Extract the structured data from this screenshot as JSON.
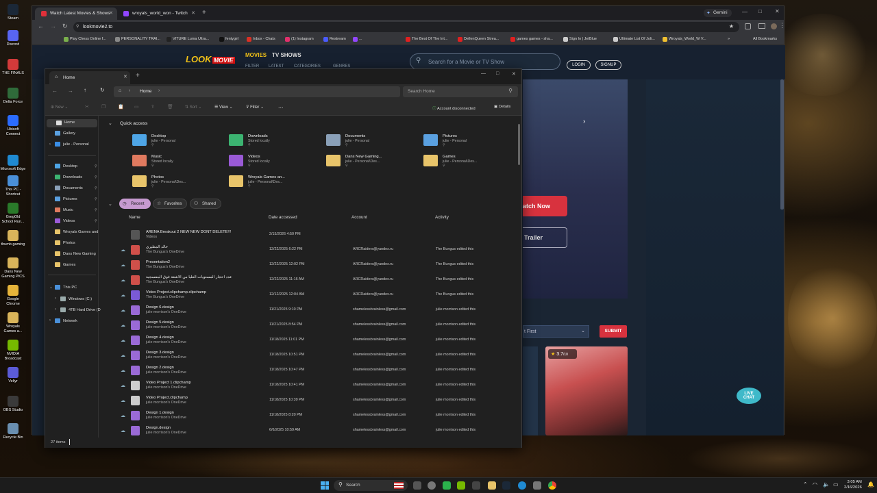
{
  "desktop": {
    "icons": [
      {
        "label": "Steam",
        "color": "#1b2838"
      },
      {
        "label": "Discord",
        "color": "#5865f2"
      },
      {
        "label": "THE FINALS",
        "color": "#d23a3a"
      },
      {
        "label": "Delta Force",
        "color": "#2f6b3a"
      },
      {
        "label": "Ubisoft Connect",
        "color": "#2b6cff"
      },
      {
        "label": "Microsoft Edge",
        "color": "#1f8ad2"
      },
      {
        "label": "This PC - Shortcut",
        "color": "#4a90d9"
      },
      {
        "label": "GregOld School Run...",
        "color": "#2a7a2a"
      },
      {
        "label": "thumb gaming",
        "color": "#d9b45a"
      },
      {
        "label": "Dans New Gaming PICS",
        "color": "#d9b45a"
      },
      {
        "label": "Google Chrome",
        "color": "#e6b43a"
      },
      {
        "label": "Wroyals Games a...",
        "color": "#d9b45a"
      },
      {
        "label": "NVIDIA Broadcast",
        "color": "#76b900"
      },
      {
        "label": "Vellyr",
        "color": "#5b5bd6"
      },
      {
        "label": "OBS Studio",
        "color": "#3a3a3a"
      },
      {
        "label": "Recycle Bin",
        "color": "#6a8fb0"
      }
    ]
  },
  "chrome": {
    "tabs": [
      {
        "title": "Watch Latest Movies & Shows",
        "active": true,
        "favicon": "#e0303a"
      },
      {
        "title": "wroyals_world_won - Twitch",
        "active": false,
        "favicon": "#9146ff"
      }
    ],
    "new_tab": "+",
    "gemini_label": "Gemini",
    "url": "lookmovie2.to",
    "bookmarks": [
      {
        "label": "Play Chess Online f...",
        "color": "#7ab04c"
      },
      {
        "label": "PERSONALITY TRAI...",
        "color": "#888888"
      },
      {
        "label": "VITURE Luma Ultra...",
        "color": "#222222"
      },
      {
        "label": "fentygirl",
        "color": "#111111"
      },
      {
        "label": "Inbox - Chats",
        "color": "#d93025"
      },
      {
        "label": "(1) Instagram",
        "color": "#e1306c"
      },
      {
        "label": "Restream",
        "color": "#4a5bff"
      },
      {
        "label": "...",
        "color": "#9146ff"
      },
      {
        "label": "The Best Of The Int...",
        "color": "#e02020"
      },
      {
        "label": "DellenQueen Strea...",
        "color": "#e02020"
      },
      {
        "label": "games games - sha...",
        "color": "#e02020"
      },
      {
        "label": "Sign In | JetBlue",
        "color": "#cccccc"
      },
      {
        "label": "Ultimate List Of Joli...",
        "color": "#cccccc"
      },
      {
        "label": "Wroyals_World_W V...",
        "color": "#f0c030"
      }
    ],
    "all_bookmarks": "All Bookmarks"
  },
  "site": {
    "logo_look": "LOOK",
    "logo_movie": "MOVIE",
    "nav": [
      "MOVIES",
      "TV SHOWS"
    ],
    "subnav": [
      "FILTER",
      "LATEST",
      "CATEGORIES",
      "GENRES"
    ],
    "search_placeholder": "Search for a Movie or TV Show",
    "login": "LOGIN",
    "signup": "SIGNUP",
    "watch_now": "atch Now",
    "trailer": "Trailer",
    "sort_value": "t First",
    "submit": "SUBMIT",
    "rating": "3.7",
    "rating_max": "/10",
    "live_chat": "LIVE CHAT"
  },
  "explorer": {
    "tab_title": "Home",
    "breadcrumb": "Home",
    "search_placeholder": "Search Home",
    "cmd": {
      "new": "New",
      "sort": "Sort",
      "view": "View",
      "filter": "Filter",
      "more": "...",
      "account": "Account disconnected",
      "details": "Details"
    },
    "nav": {
      "top": [
        {
          "label": "Home",
          "color": "#ddd"
        },
        {
          "label": "Gallery",
          "color": "#5aa0e0"
        },
        {
          "label": "julie - Personal",
          "color": "#3a8ee6"
        }
      ],
      "pinned": [
        {
          "label": "Desktop",
          "color": "#4ea5e6"
        },
        {
          "label": "Downloads",
          "color": "#3cb371"
        },
        {
          "label": "Documents",
          "color": "#8aa0b8"
        },
        {
          "label": "Pictures",
          "color": "#5aa0e0"
        },
        {
          "label": "Music",
          "color": "#e07a5f"
        },
        {
          "label": "Videos",
          "color": "#9a5ad6"
        },
        {
          "label": "Wroyals Games and",
          "color": "#e8c46a"
        },
        {
          "label": "Photos",
          "color": "#e8c46a"
        },
        {
          "label": "Dans New Gaming",
          "color": "#e8c46a"
        },
        {
          "label": "Games",
          "color": "#e8c46a"
        }
      ],
      "drives": [
        {
          "label": "This PC",
          "color": "#4a90d9"
        },
        {
          "label": "Windows (C:)",
          "color": "#9aa"
        },
        {
          "label": "4TB Hard Drive (D",
          "color": "#9aa"
        },
        {
          "label": "Network",
          "color": "#4a90d9"
        }
      ]
    },
    "quick_access_title": "Quick access",
    "quick_access": [
      {
        "name": "Desktop",
        "sub": "julie - Personal",
        "color": "#4ea5e6"
      },
      {
        "name": "Downloads",
        "sub": "Stored locally",
        "color": "#3cb371"
      },
      {
        "name": "Documents",
        "sub": "julie - Personal",
        "color": "#8aa0b8"
      },
      {
        "name": "Pictures",
        "sub": "julie - Personal",
        "color": "#5aa0e0"
      },
      {
        "name": "Music",
        "sub": "Stored locally",
        "color": "#e07a5f"
      },
      {
        "name": "Videos",
        "sub": "Stored locally",
        "color": "#9a5ad6"
      },
      {
        "name": "Dans New Gaming...",
        "sub": "julie - Personal\\Des...",
        "color": "#e8c46a"
      },
      {
        "name": "Games",
        "sub": "julie - Personal\\Des...",
        "color": "#e8c46a"
      },
      {
        "name": "Photos",
        "sub": "julie - Personal\\Des...",
        "color": "#e8c46a"
      },
      {
        "name": "Wroyals Games an...",
        "sub": "julie - Personal\\Des...",
        "color": "#e8c46a"
      }
    ],
    "filters": [
      "Recent",
      "Favorites",
      "Shared"
    ],
    "columns": [
      "Name",
      "Date accessed",
      "Account",
      "Activity"
    ],
    "files": [
      {
        "name": "ARENA Breakout 2 NEW NEW DONT DELETE!!!",
        "sub": "Videos",
        "date": "2/15/2026 4:50 PM",
        "account": "",
        "activity": "",
        "color": "#555"
      },
      {
        "name": "خالد المطيري",
        "sub": "The Bungus's OneDrive",
        "date": "12/22/2025 6:22 PM",
        "account": "ARCRaiders@yandex.ru",
        "activity": "The Bungus edited this",
        "color": "#d0504a"
      },
      {
        "name": "Presentation2",
        "sub": "The Bungus's OneDrive",
        "date": "12/22/2025 12:02 PM",
        "account": "ARCRaiders@yandex.ru",
        "activity": "The Bungus edited this",
        "color": "#d0504a"
      },
      {
        "name": "عدد احجار المستويات العليا من الاشعة فوق البنفسجية",
        "sub": "The Bungus's OneDrive",
        "date": "12/22/2025 11:16 AM",
        "account": "ARCRaiders@yandex.ru",
        "activity": "The Bungus edited this",
        "color": "#d0504a"
      },
      {
        "name": "Video Project.clipchamp.clipchamp",
        "sub": "The Bungus's OneDrive",
        "date": "12/12/2025 12:04 AM",
        "account": "ARCRaiders@yandex.ru",
        "activity": "The Bungus edited this",
        "color": "#7a5ad6"
      },
      {
        "name": "Design 6.design",
        "sub": "julie morrison's OneDrive",
        "date": "11/21/2025 9:10 PM",
        "account": "shamelessbrainless@gmail.com",
        "activity": "julie morrison edited this",
        "color": "#9a6ad6"
      },
      {
        "name": "Design 5.design",
        "sub": "julie morrison's OneDrive",
        "date": "11/21/2025 8:54 PM",
        "account": "shamelessbrainless@gmail.com",
        "activity": "julie morrison edited this",
        "color": "#9a6ad6"
      },
      {
        "name": "Design 4.design",
        "sub": "julie morrison's OneDrive",
        "date": "11/18/2025 11:01 PM",
        "account": "shamelessbrainless@gmail.com",
        "activity": "julie morrison edited this",
        "color": "#9a6ad6"
      },
      {
        "name": "Design 3.design",
        "sub": "julie morrison's OneDrive",
        "date": "11/18/2025 10:51 PM",
        "account": "shamelessbrainless@gmail.com",
        "activity": "julie morrison edited this",
        "color": "#9a6ad6"
      },
      {
        "name": "Design 2.design",
        "sub": "julie morrison's OneDrive",
        "date": "11/18/2025 10:47 PM",
        "account": "shamelessbrainless@gmail.com",
        "activity": "julie morrison edited this",
        "color": "#9a6ad6"
      },
      {
        "name": "Video Project 1.clipchamp",
        "sub": "julie morrison's OneDrive",
        "date": "11/18/2025 10:41 PM",
        "account": "shamelessbrainless@gmail.com",
        "activity": "julie morrison edited this",
        "color": "#ccc"
      },
      {
        "name": "Video Project.clipchamp",
        "sub": "julie morrison's OneDrive",
        "date": "11/18/2025 10:39 PM",
        "account": "shamelessbrainless@gmail.com",
        "activity": "julie morrison edited this",
        "color": "#ccc"
      },
      {
        "name": "Design 1.design",
        "sub": "julie morrison's OneDrive",
        "date": "11/18/2025 8:20 PM",
        "account": "shamelessbrainless@gmail.com",
        "activity": "julie morrison edited this",
        "color": "#9a6ad6"
      },
      {
        "name": "Design.design",
        "sub": "julie morrison's OneDrive",
        "date": "6/6/2025 10:59 AM",
        "account": "shamelessbrainless@gmail.com",
        "activity": "julie morrison edited this",
        "color": "#9a6ad6"
      }
    ],
    "status": "27 items"
  },
  "taskbar": {
    "search": "Search",
    "time": "3:05 AM",
    "date": "2/16/2026"
  }
}
